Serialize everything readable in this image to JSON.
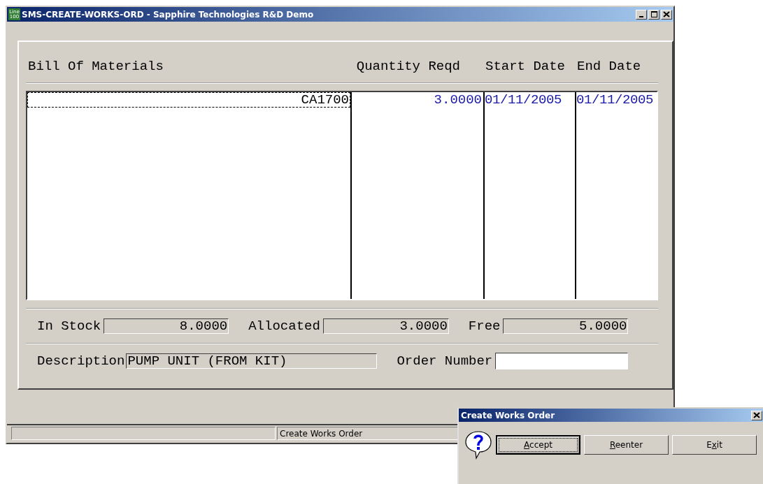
{
  "window": {
    "title": "SMS-CREATE-WORKS-ORD - Sapphire Technologies R&D Demo",
    "app_icon_lines": [
      "Line",
      "100"
    ]
  },
  "grid": {
    "columns": [
      "Bill Of Materials",
      "Quantity Reqd",
      "Start Date",
      "End Date"
    ],
    "rows": [
      {
        "focused": true,
        "cells": [
          "CA1700",
          "3.0000",
          "01/11/2005",
          "01/11/2005"
        ]
      }
    ]
  },
  "stock": [
    {
      "label": "In Stock",
      "value": "8.0000"
    },
    {
      "label": "Allocated",
      "value": "3.0000"
    },
    {
      "label": "Free",
      "value": "5.0000"
    }
  ],
  "description": {
    "label": "Description",
    "value": "PUMP UNIT (FROM KIT)"
  },
  "order_number": {
    "label": "Order Number"
  },
  "status_bar": {
    "text": "Create Works Order"
  },
  "dialog": {
    "title": "Create Works Order",
    "buttons": [
      {
        "key": "A",
        "after": "ccept",
        "default": true
      },
      {
        "key": "R",
        "after": "eenter",
        "default": false
      },
      {
        "before": "E",
        "key": "x",
        "after": "it",
        "default": false
      }
    ]
  }
}
